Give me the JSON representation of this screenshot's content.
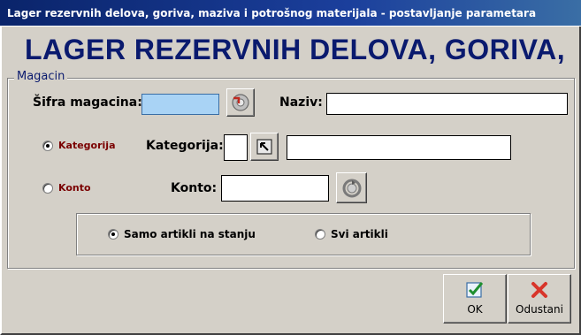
{
  "window": {
    "title": "Lager rezervnih delova, goriva, maziva i potrošnog materijala - postavljanje parametara"
  },
  "header": {
    "text": "LAGER REZERVNIH DELOVA, GORIVA,"
  },
  "magacin_group": {
    "label": "Magacin",
    "sifra_label": "Šifra magacina:",
    "sifra_value": "",
    "naziv_label": "Naziv:",
    "naziv_value": "",
    "lookup_icon": "gear-lookup-icon"
  },
  "kategorija": {
    "radio_label": "Kategorija",
    "selected": true,
    "field_label": "Kategorija:",
    "code_value": "",
    "name_value": "",
    "button_icon": "cursor-arrow-icon"
  },
  "konto": {
    "radio_label": "Konto",
    "selected": false,
    "field_label": "Konto:",
    "value": "",
    "button_icon": "refresh-circle-icon"
  },
  "stock_filter": {
    "option_in_stock": "Samo artikli na stanju",
    "option_all": "Svi artikli",
    "selected": "in_stock"
  },
  "buttons": {
    "ok_label": "OK",
    "cancel_label": "Odustani",
    "ok_icon": "check-icon",
    "cancel_icon": "x-icon"
  },
  "colors": {
    "title_bar": "#0a246a",
    "header_text": "#0a1a6e",
    "active_field": "#a9d3f5",
    "radio_label_maroon": "#7a0000",
    "face": "#d4d0c8"
  }
}
